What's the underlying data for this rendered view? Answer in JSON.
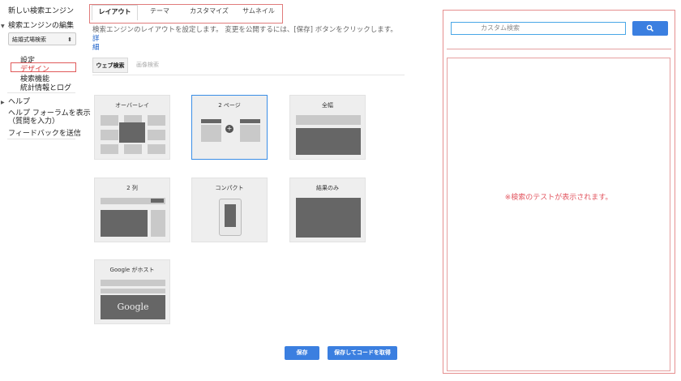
{
  "sidebar": {
    "new_engine": "新しい検索エンジン",
    "edit_engine": "検索エンジンの編集",
    "selected_engine": "結婚式場検索",
    "items": [
      {
        "label": "設定"
      },
      {
        "label": "デザイン"
      },
      {
        "label": "検索機能"
      },
      {
        "label": "統計情報とログ"
      }
    ],
    "help": "ヘルプ",
    "help_forum_line1": "ヘルプ フォーラムを表示",
    "help_forum_line2": "（質問を入力）",
    "feedback": "フィードバックを送信"
  },
  "tabs": [
    {
      "label": "レイアウト"
    },
    {
      "label": "テーマ"
    },
    {
      "label": "カスタマイズ"
    },
    {
      "label": "サムネイル"
    }
  ],
  "description": "検索エンジンのレイアウトを設定します。 変更を公開するには、[保存] ボタンをクリックします。",
  "description_link_1": "詳",
  "description_link_2": "細",
  "subtabs": [
    {
      "label": "ウェブ検索"
    },
    {
      "label": "画像検索"
    }
  ],
  "layouts": [
    {
      "label": "オーバーレイ"
    },
    {
      "label": "2 ページ"
    },
    {
      "label": "全幅"
    },
    {
      "label": "2 列"
    },
    {
      "label": "コンパクト"
    },
    {
      "label": "結果のみ"
    },
    {
      "label": "Google がホスト"
    }
  ],
  "google_logo_text": "Google",
  "buttons": {
    "save": "保存",
    "save_get_code": "保存してコードを取得"
  },
  "preview": {
    "search_placeholder": "カスタム検索",
    "message": "※検索のテストが表示されます。"
  },
  "colors": {
    "accent_blue": "#3b7fe0",
    "highlight_red": "#e05a5a"
  }
}
